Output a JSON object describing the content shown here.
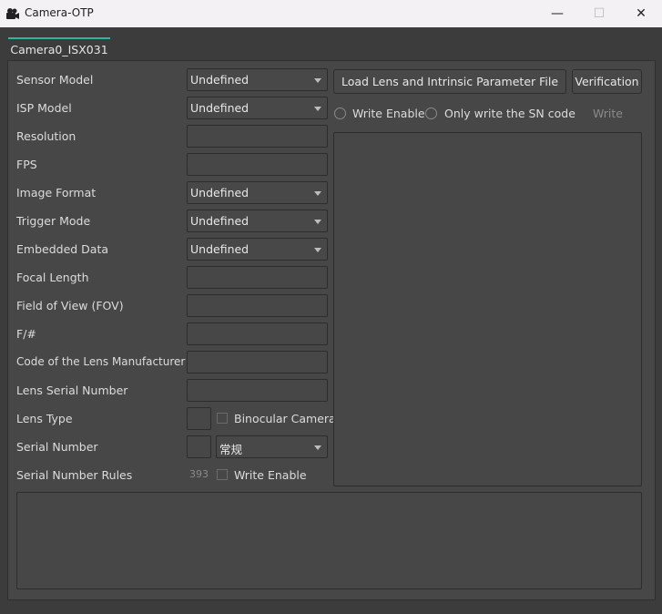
{
  "window": {
    "title": "Camera-OTP",
    "minimize": "—",
    "maximize": "☐",
    "close": "✕"
  },
  "tabs": [
    {
      "label": "Camera0_ISX031"
    }
  ],
  "form": {
    "sensor_model": {
      "label": "Sensor Model",
      "value": "Undefined"
    },
    "isp_model": {
      "label": "ISP Model",
      "value": "Undefined"
    },
    "resolution": {
      "label": "Resolution",
      "value": ""
    },
    "fps": {
      "label": "FPS",
      "value": ""
    },
    "image_format": {
      "label": "Image Format",
      "value": "Undefined"
    },
    "trigger_mode": {
      "label": "Trigger Mode",
      "value": "Undefined"
    },
    "embedded_data": {
      "label": "Embedded Data",
      "value": "Undefined"
    },
    "focal_length": {
      "label": "Focal Length",
      "value": ""
    },
    "fov": {
      "label": "Field of View (FOV)",
      "value": ""
    },
    "f_number": {
      "label": "F/#",
      "value": ""
    },
    "lens_manufacturer_code": {
      "label": "Code of the Lens Manufacturer",
      "value": ""
    },
    "lens_serial_number": {
      "label": "Lens Serial Number",
      "value": ""
    },
    "lens_type": {
      "label": "Lens Type",
      "value": "",
      "binocular_label": "Binocular Camera"
    },
    "serial_number": {
      "label": "Serial Number",
      "value": "",
      "mode_value": "常规"
    },
    "serial_number_rules": {
      "label": "Serial Number Rules",
      "value": "393",
      "write_enable_label": "Write Enable"
    }
  },
  "actions": {
    "load_file": "Load Lens and Intrinsic Parameter File",
    "verification": "Verification",
    "write_enable_radio": "Write Enable",
    "only_sn_radio": "Only write the SN code",
    "write": "Write"
  }
}
